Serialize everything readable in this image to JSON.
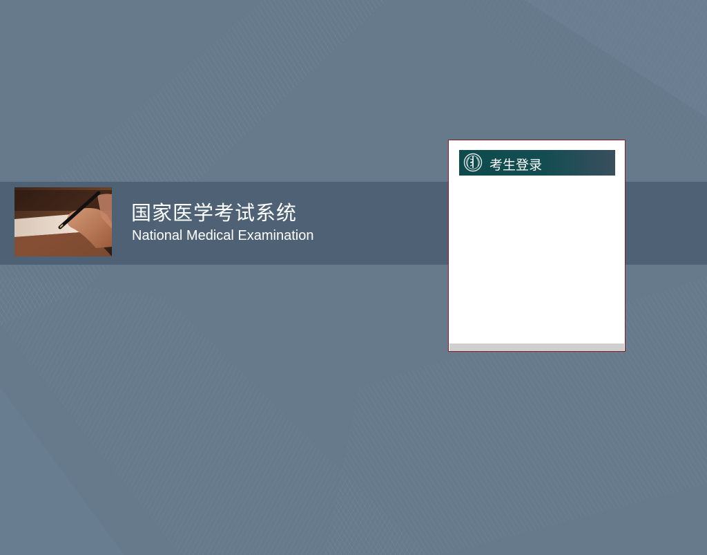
{
  "banner": {
    "title": "国家医学考试系统",
    "subtitle": "National Medical Examination",
    "photo_icon": "hand-writing-with-pen-image"
  },
  "login": {
    "title": "考生登录",
    "emblem_icon": "medical-emblem-icon"
  },
  "colors": {
    "background": "#667a8c",
    "banner": "#4e6175",
    "panel_border": "#8b1a24",
    "header_teal": "#134d52"
  }
}
